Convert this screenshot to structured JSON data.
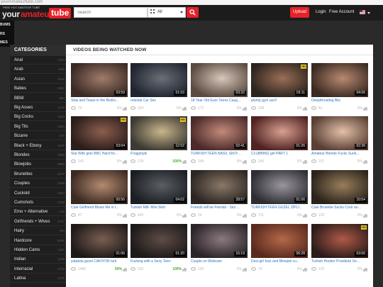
{
  "url": "yourAmateurtube.com",
  "header": {
    "logo_tagline": "FREE HOT AMATEUR TUBE",
    "logo_part1": "your",
    "logo_part2": "amateur",
    "logo_part3": "tube",
    "search_placeholder": "Search",
    "search_scope": "All",
    "upload_label": "Upload",
    "login_label": "Login",
    "free_account_label": "Free Account",
    "flag_icon": "us-flag-icon"
  },
  "left_nav": [
    "BUMS",
    "RS",
    "MES"
  ],
  "sidebar": {
    "title": "CATEGORIES",
    "categories": [
      {
        "name": "Anal",
        "count": "1444"
      },
      {
        "name": "Arab",
        "count": "1118"
      },
      {
        "name": "Asian",
        "count": "2112"
      },
      {
        "name": "Babes",
        "count": "2562"
      },
      {
        "name": "BBW",
        "count": "892"
      },
      {
        "name": "Big Asses",
        "count": "1132"
      },
      {
        "name": "Big Cocks",
        "count": "1024"
      },
      {
        "name": "Big Tits",
        "count": "1254"
      },
      {
        "name": "Bizarre",
        "count": "477"
      },
      {
        "name": "Black + Ebony",
        "count": "1197"
      },
      {
        "name": "Blondes",
        "count": "1829"
      },
      {
        "name": "Blowjobs",
        "count": "3960"
      },
      {
        "name": "Brunettes",
        "count": "1477"
      },
      {
        "name": "Couples",
        "count": "2398"
      },
      {
        "name": "Cuckold",
        "count": "1334"
      },
      {
        "name": "Cumshots",
        "count": "1702"
      },
      {
        "name": "Emo + Alternative",
        "count": "129"
      },
      {
        "name": "Girlfriends + Wives",
        "count": "4727"
      },
      {
        "name": "Hairy",
        "count": "794"
      },
      {
        "name": "Hardcore",
        "count": "8461"
      },
      {
        "name": "Hidden Cams",
        "count": "1287"
      },
      {
        "name": "Indian",
        "count": "1188"
      },
      {
        "name": "Interracial",
        "count": "1728"
      },
      {
        "name": "Latina",
        "count": "1375"
      }
    ]
  },
  "main": {
    "title": "VIDEOS BEING WATCHED NOW",
    "videos": [
      {
        "title": "Strip and Tease in the Bedro...",
        "duration": "03:59",
        "hd": false,
        "views": "70",
        "rating": "0%"
      },
      {
        "title": "oriental Car Sex",
        "duration": "01:03",
        "hd": false,
        "views": "324",
        "rating": "0%"
      },
      {
        "title": "18 Year Old Euro Teens Caug...",
        "duration": "03:32",
        "hd": false,
        "views": "172",
        "rating": "0%"
      },
      {
        "title": "plump gym ass!!",
        "duration": "03:11",
        "hd": true,
        "views": "238",
        "rating": "0%"
      },
      {
        "title": "Deepthroating Bbc",
        "duration": "04:06",
        "hd": false,
        "views": "81",
        "rating": "0%"
      },
      {
        "title": "Slut Wife gets BBC Hard fro...",
        "duration": "03:04",
        "hd": true,
        "views": "142",
        "rating": "0%"
      },
      {
        "title": "Froggstyle",
        "duration": "12:02",
        "hd": true,
        "views": "278",
        "rating": "100%"
      },
      {
        "title": "TURKISH TEEN NASIL SIKIY...",
        "duration": "02:41",
        "hd": false,
        "views": "209",
        "rating": "0%"
      },
      {
        "title": "CLUBBING girl PART 1",
        "duration": "01:26",
        "hd": false,
        "views": "246",
        "rating": "0%"
      },
      {
        "title": "Amateur Blonde Fucks Sunk...",
        "duration": "02:26",
        "hd": false,
        "views": "237",
        "rating": "0%"
      },
      {
        "title": "Cute Girlfriend Blows Me in t...",
        "duration": "00:56",
        "hd": false,
        "views": "87",
        "rating": "0%"
      },
      {
        "title": "Turkish Milf- Mini Skirt",
        "duration": "04:02",
        "hd": false,
        "views": "443",
        "rating": "0%"
      },
      {
        "title": "Friends will be Friends - Slut ...",
        "duration": "28:57",
        "hd": false,
        "views": "54",
        "rating": "0%"
      },
      {
        "title": "TURKISH TEEN GUZEL ZIPLI...",
        "duration": "01:06",
        "hd": false,
        "views": "711",
        "rating": "0%"
      },
      {
        "title": "Cute Brunette Sucks Cock an...",
        "duration": "10:54",
        "hd": false,
        "views": "125",
        "rating": "0%"
      },
      {
        "title": "yatakda guzel CAKIYOR turk",
        "duration": "01:06",
        "hd": false,
        "views": "1480",
        "rating": "50%"
      },
      {
        "title": "Fucking with a Sexy Teen",
        "duration": "01:20",
        "hd": false,
        "views": "203",
        "rating": "100%"
      },
      {
        "title": "Couple on Webcam",
        "duration": "15:19",
        "hd": false,
        "views": "130",
        "rating": "0%"
      },
      {
        "title": "Desi girl fuck and Blowjob cu...",
        "duration": "06:28",
        "hd": false,
        "views": "79",
        "rating": "0%"
      },
      {
        "title": "Turkish Hooker Prostitute Se...",
        "duration": "03:00",
        "hd": true,
        "views": "125",
        "rating": "0%"
      }
    ]
  },
  "colors": {
    "accent": "#e62228",
    "link": "#2a72c4",
    "rating_high": "#4aa832",
    "header_bg": "#1c1c1c",
    "sidebar_bg": "#1f1f1f"
  }
}
